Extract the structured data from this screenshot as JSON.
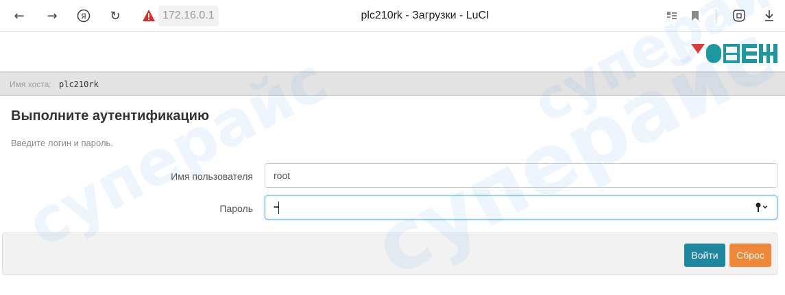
{
  "browser": {
    "url": "172.16.0.1",
    "tab_title": "plc210rk - Загрузки - LuCI",
    "icons": [
      "back-arrow-icon",
      "forward-arrow-icon",
      "yandex-icon",
      "reload-icon",
      "warning-icon",
      "reader-mode-icon",
      "bookmark-icon",
      "protect-icon",
      "download-icon"
    ]
  },
  "header": {
    "logo_text": "ОВЕН"
  },
  "hostbar": {
    "label": "Имя хоста:",
    "hostname": "plc210rk"
  },
  "auth": {
    "title": "Выполните аутентификацию",
    "description": "Введите логин и пароль.",
    "username_label": "Имя пользователя",
    "username_value": "root",
    "password_label": "Пароль",
    "password_value": "••••"
  },
  "actions": {
    "login_label": "Войти",
    "reset_label": "Сброс"
  },
  "watermark": {
    "text": "суперайс"
  },
  "colors": {
    "login_button": "#1e87a0",
    "reset_button": "#f0883a",
    "logo_red": "#e53935",
    "logo_teal": "#1a9a9e",
    "warning_red": "#d93025"
  }
}
